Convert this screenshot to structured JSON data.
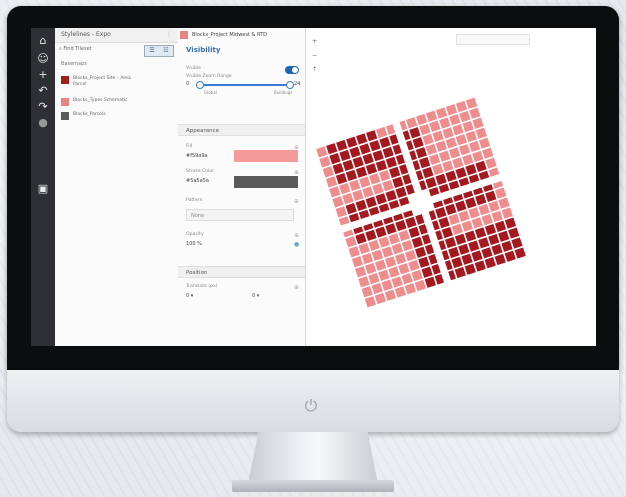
{
  "app": {
    "layers_tab": "Stylelines - Expo",
    "props_tab": "Blocks_Project Midwest & RTD",
    "map_tab": ""
  },
  "layers": {
    "search_placeholder": "Find Tileset",
    "view_toggle": [
      "☰",
      "☷"
    ],
    "group_label": "Basemaps",
    "items": [
      {
        "label": "Blocks_Project Site – Area Parcel",
        "color": "#a01e22"
      },
      {
        "label": "Blocks_Types Schematic",
        "color": "#e88482"
      },
      {
        "label": "Blocks_Parcels",
        "color": "#5a5a5a"
      }
    ]
  },
  "props": {
    "visibility_title": "Visibility",
    "visible_label": "Visible",
    "zoom_label": "Visible Zoom Range",
    "zoom_min": "0",
    "zoom_max": "24",
    "zoom_min_caption": "Global",
    "zoom_max_caption": "Buildings",
    "appearance_title": "Appearance",
    "fill_label": "Fill",
    "fill_value": "#f59a9a",
    "stroke_label": "Stroke Color",
    "stroke_value": "#5a5a5a",
    "pattern_label": "Pattern",
    "pattern_value": "None",
    "opacity_label": "Opacity",
    "opacity_value": "100 %",
    "position_title": "Position",
    "translate_label": "Translate (px)",
    "translate_x": "0 ▾",
    "translate_y": "0 ▾"
  },
  "map": {
    "zoom_in": "+",
    "zoom_out": "−",
    "compass": "⇡"
  },
  "colors": {
    "dark_block": "#a4191f",
    "light_block": "#ef8c8d",
    "street": "#ffffff"
  },
  "icons": [
    "home-icon",
    "users-icon",
    "add-icon",
    "undo-icon",
    "redo-icon",
    "image-icon"
  ]
}
